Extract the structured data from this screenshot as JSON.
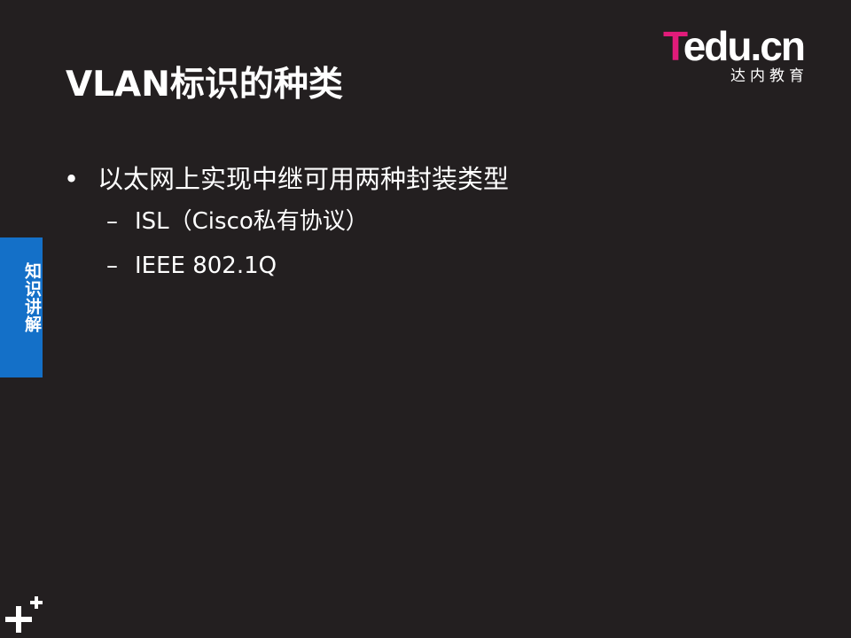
{
  "logo": {
    "brand_initial": "T",
    "brand_rest": "edu.cn",
    "subtitle": "达内教育",
    "accent_color": "#e21b7a"
  },
  "slide": {
    "title": "VLAN标识的种类",
    "background_color": "#231f20",
    "bullets": [
      {
        "marker": "•",
        "text": "以太网上实现中继可用两种封装类型",
        "children": [
          {
            "marker": "–",
            "text": "ISL（Cisco私有协议）"
          },
          {
            "marker": "–",
            "text": "IEEE 802.1Q"
          }
        ]
      }
    ]
  },
  "side_tab": {
    "label": "知识讲解",
    "color": "#1470c8"
  },
  "icons": {
    "corner": "plus-icon"
  }
}
